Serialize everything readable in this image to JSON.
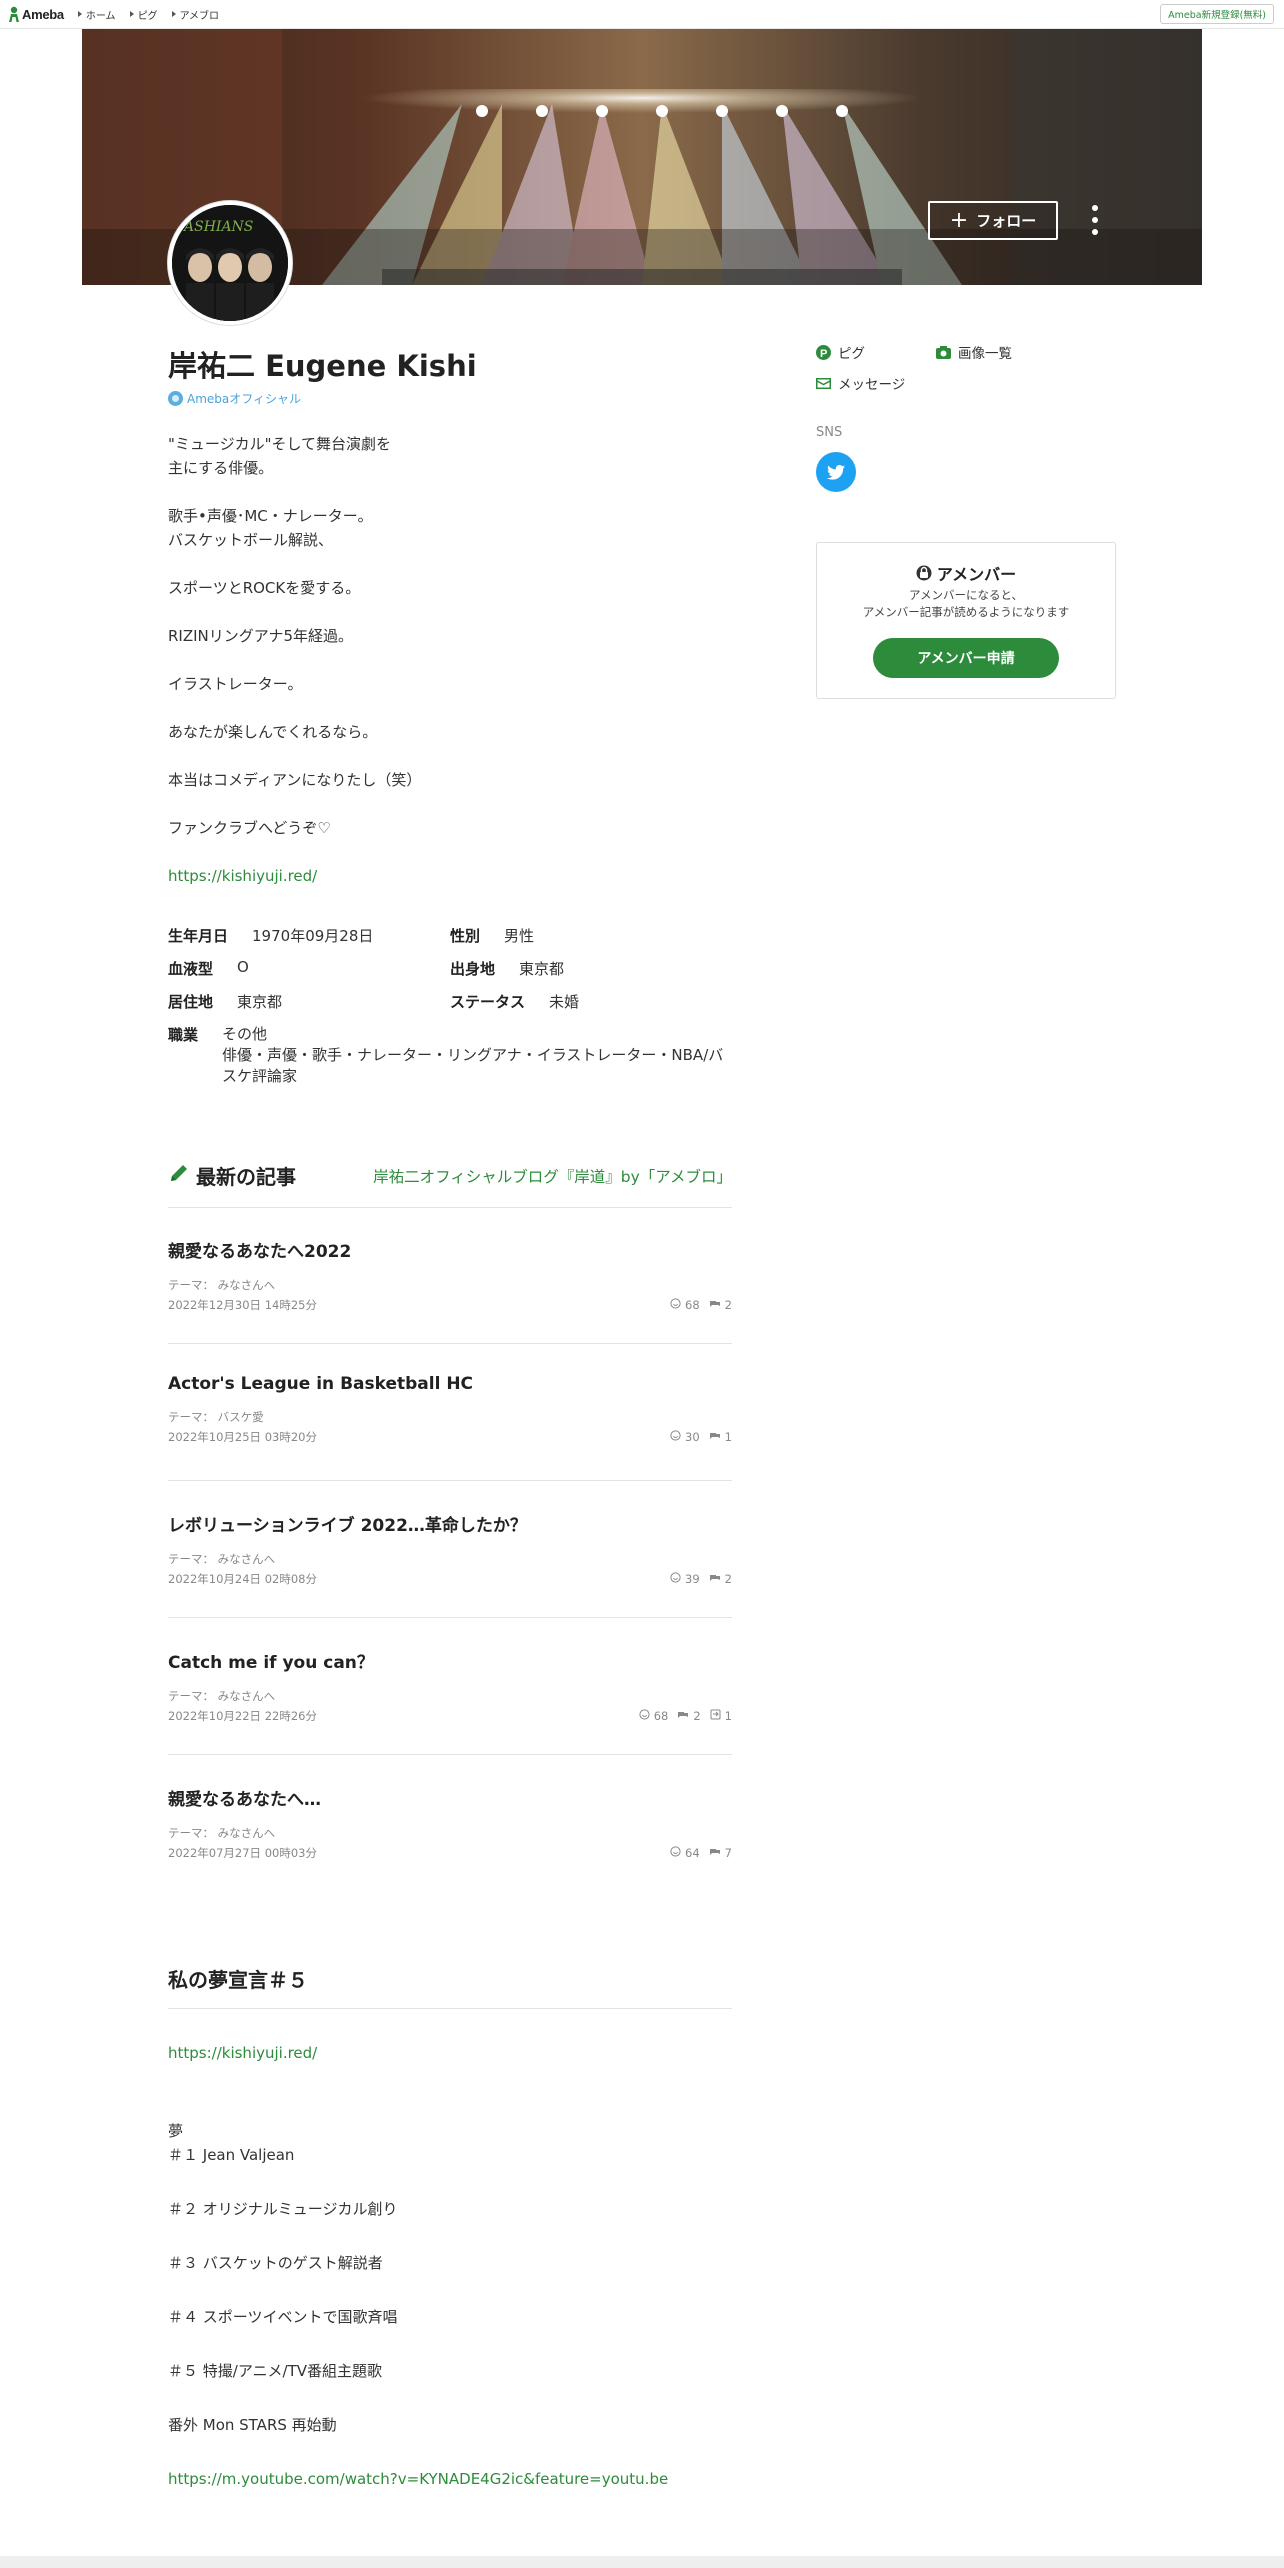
{
  "topbar": {
    "logo_text": "Ameba",
    "nav": [
      "ホーム",
      "ピグ",
      "アメブロ"
    ],
    "signup": "Ameba新規登録(無料)"
  },
  "header": {
    "follow_label": "フォロー"
  },
  "profile": {
    "name": "岸祐二 Eugene Kishi",
    "official_label": "Amebaオフィシャル",
    "bio": [
      "\"ミュージカル\"そして舞台演劇を\n主にする俳優。",
      "歌手•声優･MC・ナレーター。\nバスケットボール解説、",
      "スポーツとROCKを愛する。",
      "RIZINリングアナ5年経過。",
      "イラストレーター。",
      "あなたが楽しんでくれるなら。",
      "本当はコメディアンになりたし（笑）",
      "ファンクラブへどうぞ♡"
    ],
    "bio_link": "https://kishiyuji.red/",
    "info": {
      "birthday_label": "生年月日",
      "birthday": "1970年09月28日",
      "gender_label": "性別",
      "gender": "男性",
      "blood_label": "血液型",
      "blood": "O",
      "birthplace_label": "出身地",
      "birthplace": "東京都",
      "residence_label": "居住地",
      "residence": "東京都",
      "status_label": "ステータス",
      "status": "未婚",
      "job_label": "職業",
      "job_category": "その他",
      "job_detail": "俳優・声優・歌手・ナレーター・リングアナ・イラストレーター・NBA/バスケ評論家"
    }
  },
  "sidebar": {
    "links": [
      "ピグ",
      "画像一覧",
      "メッセージ"
    ],
    "sns_label": "SNS",
    "amember": {
      "title": "アメンバー",
      "desc": "アメンバーになると、\nアメンバー記事が読めるようになります",
      "button": "アメンバー申請"
    }
  },
  "latest": {
    "title": "最新の記事",
    "blog_link": "岸祐二オフィシャルブログ『岸道』by「アメブロ」",
    "articles": [
      {
        "title": "親愛なるあなたへ2022",
        "theme": "テーマ： みなさんへ",
        "date": "2022年12月30日 14時25分",
        "likes": "68",
        "comments": "2",
        "reblogs": ""
      },
      {
        "title": "Actor's League in Basketball HC",
        "theme": "テーマ： バスケ愛",
        "date": "2022年10月25日 03時20分",
        "likes": "30",
        "comments": "1",
        "reblogs": ""
      },
      {
        "title": "レボリューションライブ 2022…革命したか？",
        "theme": "テーマ： みなさんへ",
        "date": "2022年10月24日 02時08分",
        "likes": "39",
        "comments": "2",
        "reblogs": ""
      },
      {
        "title": "Catch me if you can？",
        "theme": "テーマ： みなさんへ",
        "date": "2022年10月22日 22時26分",
        "likes": "68",
        "comments": "2",
        "reblogs": "1"
      },
      {
        "title": "親愛なるあなたへ…",
        "theme": "テーマ： みなさんへ",
        "date": "2022年07月27日 00時03分",
        "likes": "64",
        "comments": "7",
        "reblogs": ""
      }
    ]
  },
  "feature": {
    "title": "私の夢宣言＃５",
    "link1": "https://kishiyuji.red/",
    "lines": [
      "夢",
      "＃１ Jean Valjean",
      "＃２ オリジナルミュージカル創り",
      "＃３ バスケットのゲスト解説者",
      "＃４ スポーツイベントで国歌斉唱",
      "＃５ 特撮/アニメ/TV番組主題歌",
      "番外 Mon STARS 再始動"
    ],
    "link2": "https://m.youtube.com/watch?v=KYNADE4G2ic&feature=youtu.be"
  },
  "colors": {
    "accent_green": "#2d8c3c",
    "official_blue": "#4aa3d8",
    "twitter_blue": "#1da1f2"
  }
}
